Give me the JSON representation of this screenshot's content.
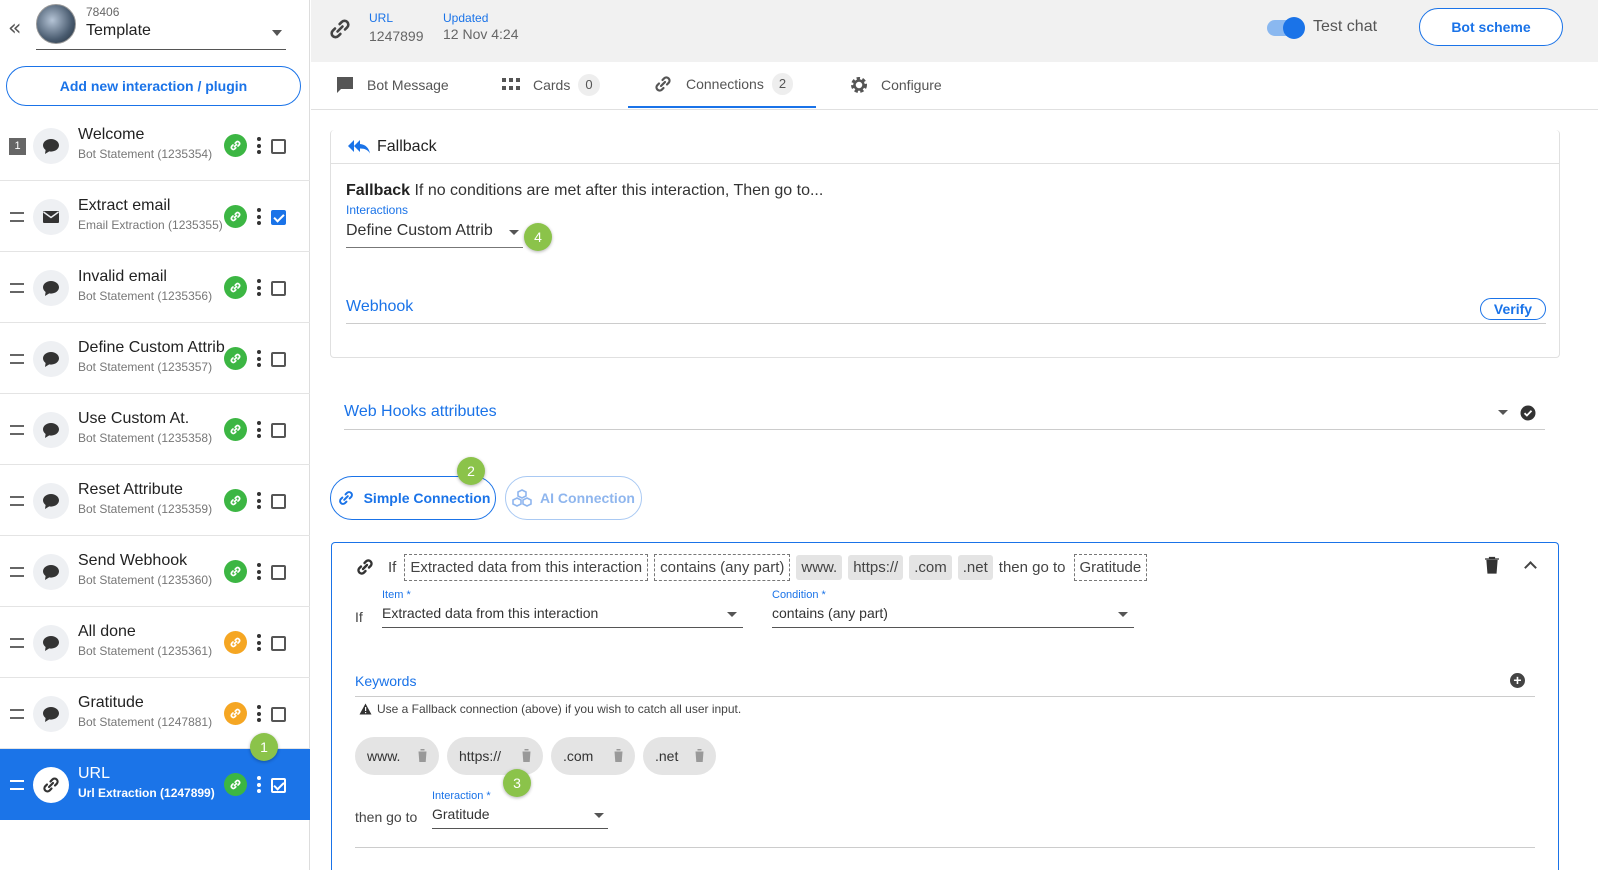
{
  "bot": {
    "id": "78406",
    "name": "Template"
  },
  "sidebar": {
    "add_label": "Add new interaction / plugin",
    "items": [
      {
        "title": "Welcome",
        "subtitle": "Bot Statement (1235354)",
        "marker": "1"
      },
      {
        "title": "Extract email",
        "subtitle": "Email Extraction (1235355)"
      },
      {
        "title": "Invalid email",
        "subtitle": "Bot Statement (1235356)"
      },
      {
        "title": "Define Custom Attrib",
        "subtitle": "Bot Statement (1235357)"
      },
      {
        "title": "Use Custom At.",
        "subtitle": "Bot Statement (1235358)"
      },
      {
        "title": "Reset Attribute",
        "subtitle": "Bot Statement (1235359)"
      },
      {
        "title": "Send Webhook",
        "subtitle": "Bot Statement (1235360)"
      },
      {
        "title": "All done",
        "subtitle": "Bot Statement (1235361)"
      },
      {
        "title": "Gratitude",
        "subtitle": "Bot Statement (1247881)"
      },
      {
        "title": "URL",
        "subtitle": "Url Extraction (1247899)"
      }
    ]
  },
  "steps": {
    "one": "1",
    "two": "2",
    "three": "3",
    "four": "4"
  },
  "header": {
    "url_label": "URL",
    "url_value": "1247899",
    "updated_label": "Updated",
    "updated_value": "12 Nov 4:24",
    "test_chat_label": "Test chat",
    "bot_scheme_label": "Bot scheme"
  },
  "tabs": [
    {
      "label": "Bot Message"
    },
    {
      "label": "Cards",
      "count": "0"
    },
    {
      "label": "Connections",
      "count": "2"
    },
    {
      "label": "Configure"
    }
  ],
  "fallback": {
    "title": "Fallback",
    "desc_bold": "Fallback",
    "desc_rest": " If no conditions are met after this interaction, Then go to...",
    "interactions_label": "Interactions",
    "interaction_value": "Define Custom Attrib",
    "webhook_label": "Webhook",
    "verify_label": "Verify"
  },
  "webhooks_attributes_label": "Web Hooks attributes",
  "connection_types": {
    "simple": "Simple Connection",
    "ai": "AI Connection"
  },
  "connection": {
    "summary": {
      "if": "If",
      "item": "Extracted data from this interaction",
      "condition": "contains (any part)",
      "keywords": [
        "www.",
        "https://",
        ".com",
        ".net"
      ],
      "then": "then go to",
      "target": "Gratitude"
    },
    "if_label": "If",
    "item_label": "Item *",
    "item_value": "Extracted data from this interaction",
    "condition_label": "Condition *",
    "condition_value": "contains (any part)",
    "keywords_label": "Keywords",
    "warning": "Use a Fallback connection (above) if you wish to catch all user input.",
    "chips": [
      "www.",
      "https://",
      ".com",
      ".net"
    ],
    "then_go_to": "then go to",
    "interaction_label": "Interaction *",
    "interaction_value": "Gratitude"
  },
  "colors": {
    "accent": "#1a73e8",
    "link_green": "#3cb643",
    "link_orange": "#f5a623",
    "step_green": "#8bc34a"
  }
}
